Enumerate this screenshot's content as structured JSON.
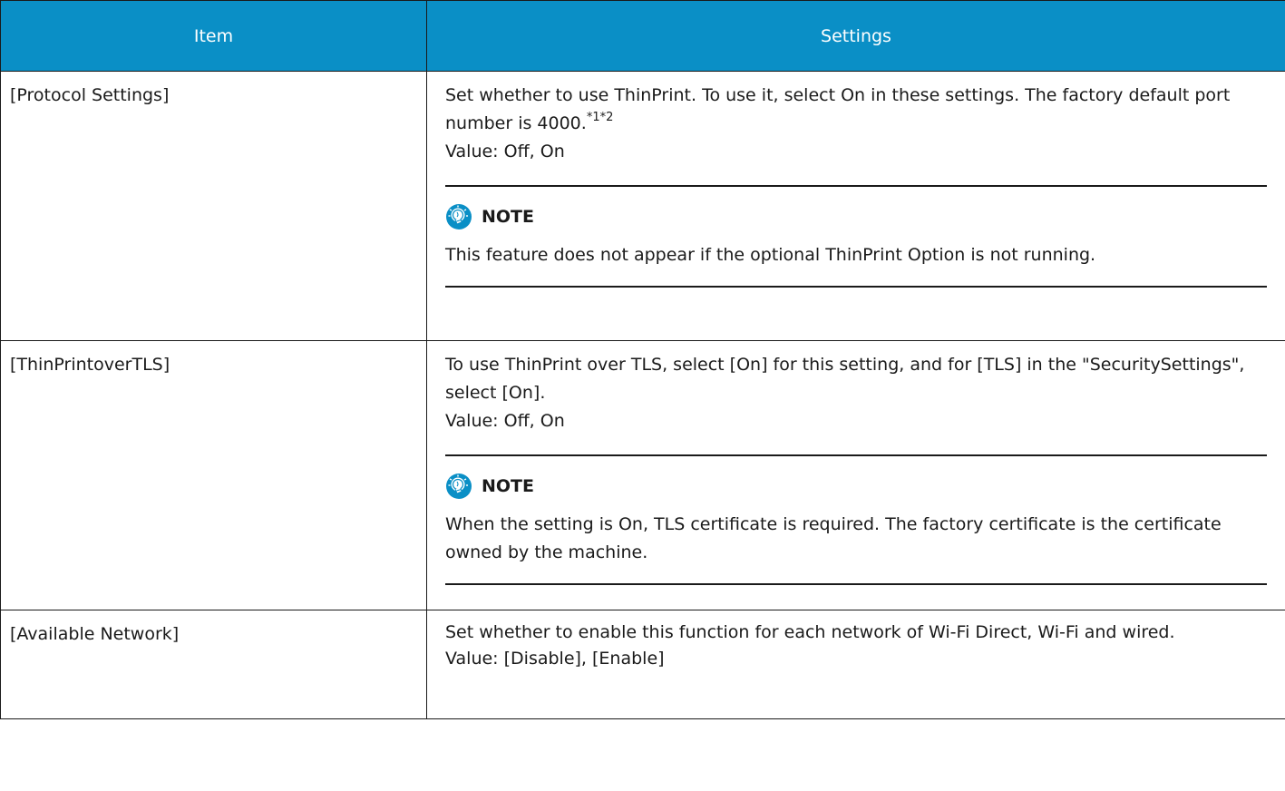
{
  "header": {
    "item": "Item",
    "settings": "Settings"
  },
  "rows": [
    {
      "item": "[Protocol Settings]",
      "description": "Set whether to use ThinPrint. To use it, select On in these settings. The factory default port number is 4000.",
      "footnote": "*1*2",
      "value": "Value: Off, On",
      "note": {
        "label": "NOTE",
        "icon": "lightbulb-note-icon",
        "text": "This feature does not appear if the optional ThinPrint Option is not running."
      }
    },
    {
      "item": "[ThinPrintoverTLS]",
      "description": "To use ThinPrint over TLS, select [On] for this setting, and for [TLS] in the \"SecuritySettings\", select [On].",
      "value": "Value: Off, On",
      "note": {
        "label": "NOTE",
        "icon": "lightbulb-note-icon",
        "text": "When the setting is On, TLS certificate is required. The factory certificate is the certificate owned by the machine."
      }
    },
    {
      "item": "[Available Network]",
      "description": "Set whether to enable this function for each network of Wi-Fi Direct, Wi-Fi and wired.",
      "value": "Value: [Disable], [Enable]"
    }
  ],
  "colors": {
    "header_bg": "#0a8fc6",
    "header_text": "#ffffff",
    "border": "#1a1a1a"
  }
}
